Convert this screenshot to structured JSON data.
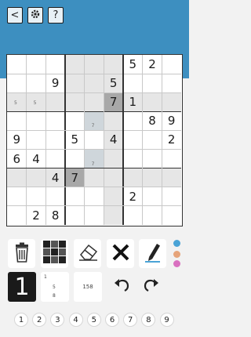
{
  "toolbar": {
    "back_label": "<",
    "help_label": "?"
  },
  "grid": {
    "givens": [
      {
        "r": 0,
        "c": 6,
        "v": "5"
      },
      {
        "r": 0,
        "c": 7,
        "v": "2"
      },
      {
        "r": 1,
        "c": 2,
        "v": "9"
      },
      {
        "r": 1,
        "c": 5,
        "v": "5"
      },
      {
        "r": 2,
        "c": 5,
        "v": "7"
      },
      {
        "r": 2,
        "c": 6,
        "v": "1"
      },
      {
        "r": 3,
        "c": 7,
        "v": "8"
      },
      {
        "r": 3,
        "c": 8,
        "v": "9"
      },
      {
        "r": 4,
        "c": 0,
        "v": "9"
      },
      {
        "r": 4,
        "c": 3,
        "v": "5"
      },
      {
        "r": 4,
        "c": 5,
        "v": "4"
      },
      {
        "r": 4,
        "c": 8,
        "v": "2"
      },
      {
        "r": 5,
        "c": 0,
        "v": "6"
      },
      {
        "r": 5,
        "c": 1,
        "v": "4"
      },
      {
        "r": 6,
        "c": 2,
        "v": "4"
      },
      {
        "r": 6,
        "c": 3,
        "v": "7"
      },
      {
        "r": 7,
        "c": 6,
        "v": "2"
      },
      {
        "r": 8,
        "c": 1,
        "v": "2"
      },
      {
        "r": 8,
        "c": 2,
        "v": "8"
      }
    ],
    "notes": [
      {
        "r": 2,
        "c": 0,
        "v": "5"
      },
      {
        "r": 2,
        "c": 1,
        "v": "5"
      },
      {
        "r": 3,
        "c": 4,
        "v": "7"
      },
      {
        "r": 5,
        "c": 4,
        "v": "7"
      }
    ],
    "selected_cells": [
      {
        "r": 2,
        "c": 5
      },
      {
        "r": 6,
        "c": 3
      }
    ],
    "colors": {
      "highlight": "#e6e6e6",
      "selected_light": "#cfd6db",
      "selected_dark": "#a8a8a8"
    }
  },
  "palette": [
    "#4aa3d6",
    "#e6a47a",
    "#d970c0"
  ],
  "modes": {
    "normal_label": "1",
    "corner_labels": [
      "1",
      "5",
      "8"
    ],
    "center_label": "158"
  },
  "numpad": [
    "1",
    "2",
    "3",
    "4",
    "5",
    "6",
    "7",
    "8",
    "9"
  ]
}
